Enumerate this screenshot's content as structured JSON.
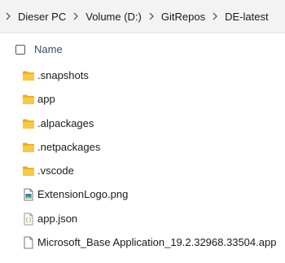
{
  "breadcrumb": {
    "items": [
      {
        "label": "Dieser PC"
      },
      {
        "label": "Volume (D:)"
      },
      {
        "label": "GitRepos"
      },
      {
        "label": "DE-latest"
      }
    ]
  },
  "list": {
    "column_name": "Name",
    "files": [
      {
        "name": ".snapshots",
        "icon": "folder-icon"
      },
      {
        "name": "app",
        "icon": "folder-icon"
      },
      {
        "name": ".alpackages",
        "icon": "folder-icon"
      },
      {
        "name": ".netpackages",
        "icon": "folder-icon"
      },
      {
        "name": ".vscode",
        "icon": "folder-icon"
      },
      {
        "name": "ExtensionLogo.png",
        "icon": "image-file-icon"
      },
      {
        "name": "app.json",
        "icon": "json-file-icon"
      },
      {
        "name": "Microsoft_Base Application_19.2.32968.33504.app",
        "icon": "document-file-icon"
      }
    ]
  },
  "colors": {
    "folder": "#f7c94b",
    "folder_dark": "#e0a92a",
    "header_text": "#3c4a6b",
    "breadcrumb_bg": "#f3f3f3"
  }
}
